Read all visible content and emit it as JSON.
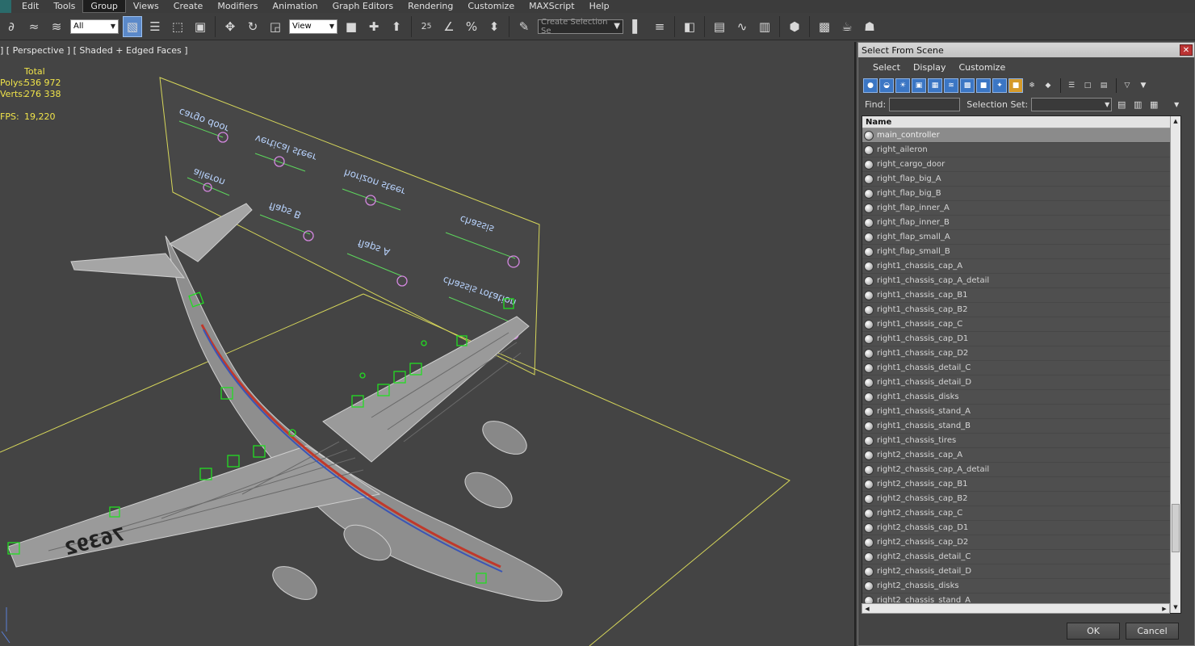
{
  "menubar": {
    "items": [
      "Edit",
      "Tools",
      "Group",
      "Views",
      "Create",
      "Modifiers",
      "Animation",
      "Graph Editors",
      "Rendering",
      "Customize",
      "MAXScript",
      "Help"
    ],
    "active": "Group"
  },
  "toolbar": {
    "filter_value": "All",
    "ref_coord_value": "View",
    "snap_angle_label": "2.5",
    "selection_set_placeholder": "Create Selection Se"
  },
  "viewport": {
    "label": "] [ Perspective ] [ Shaded + Edged Faces ]",
    "stats": {
      "header": "Total",
      "polys_label": "Polys:",
      "polys_value": "536 972",
      "verts_label": "Verts:",
      "verts_value": "276 338",
      "fps_label": "FPS:",
      "fps_value": "19,220"
    },
    "panel_labels": [
      "cargo door",
      "vertical steer",
      "horizon steer",
      "chassis",
      "aileron",
      "flaps B",
      "flaps A",
      "chassis rotation"
    ],
    "aircraft_number": "76392"
  },
  "dialog": {
    "title": "Select From Scene",
    "menu": [
      "Select",
      "Display",
      "Customize"
    ],
    "find_label": "Find:",
    "selection_set_label": "Selection Set:",
    "column_name": "Name",
    "ok_label": "OK",
    "cancel_label": "Cancel",
    "items": [
      "main_controller",
      "right_aileron",
      "right_cargo_door",
      "right_flap_big_A",
      "right_flap_big_B",
      "right_flap_inner_A",
      "right_flap_inner_B",
      "right_flap_small_A",
      "right_flap_small_B",
      "right1_chassis_cap_A",
      "right1_chassis_cap_A_detail",
      "right1_chassis_cap_B1",
      "right1_chassis_cap_B2",
      "right1_chassis_cap_C",
      "right1_chassis_cap_D1",
      "right1_chassis_cap_D2",
      "right1_chassis_detail_C",
      "right1_chassis_detail_D",
      "right1_chassis_disks",
      "right1_chassis_stand_A",
      "right1_chassis_stand_B",
      "right1_chassis_tires",
      "right2_chassis_cap_A",
      "right2_chassis_cap_A_detail",
      "right2_chassis_cap_B1",
      "right2_chassis_cap_B2",
      "right2_chassis_cap_C",
      "right2_chassis_cap_D1",
      "right2_chassis_cap_D2",
      "right2_chassis_detail_C",
      "right2_chassis_detail_D",
      "right2_chassis_disks",
      "right2_chassis_stand_A"
    ],
    "selected_index": 0
  },
  "colors": {
    "stats_text": "#f0e44a",
    "grid_line": "#d6d65a",
    "panel_text": "#b9d4ff",
    "panel_line": "#5dd65d",
    "wireframe": "#cfcfcf",
    "helper_green": "#22dd22",
    "active_blue": "#5b89c9"
  }
}
